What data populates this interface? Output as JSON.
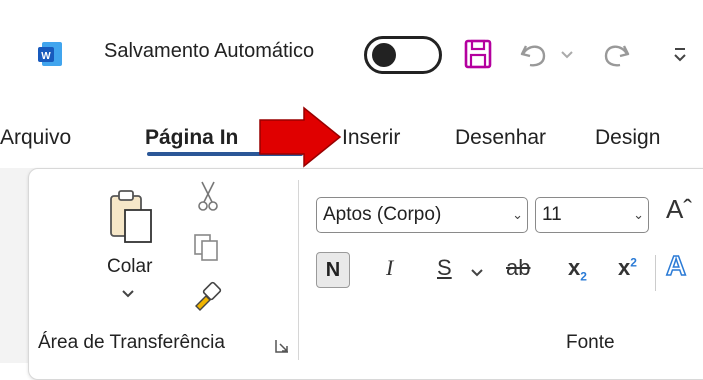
{
  "titlebar": {
    "app_icon": "word-icon",
    "autosave_label": "Salvamento Automático",
    "autosave_state": "off",
    "save_icon": "save-icon",
    "undo_icon": "undo-icon",
    "redo_icon": "redo-icon",
    "customize_icon": "customize-qat-icon"
  },
  "tabs": [
    {
      "label": "Arquivo",
      "active": false
    },
    {
      "label": "Página In",
      "active": true
    },
    {
      "label": "Inserir",
      "active": false
    },
    {
      "label": "Desenhar",
      "active": false
    },
    {
      "label": "Design",
      "active": false
    }
  ],
  "annotation": {
    "arrow_color": "#e00000"
  },
  "ribbon": {
    "clipboard": {
      "paste_label": "Colar",
      "group_label": "Área de Transferência",
      "cut_icon": "scissors-icon",
      "copy_icon": "copy-icon",
      "format_painter_icon": "format-painter-icon"
    },
    "font": {
      "font_name": "Aptos (Corpo)",
      "font_size": "11",
      "bold": "N",
      "italic": "I",
      "underline": "S",
      "strikethrough": "ab",
      "subscript": "x",
      "superscript": "x",
      "group_label": "Fonte"
    }
  },
  "colors": {
    "accent": "#2b5797",
    "save_icon": "#b4009e",
    "word_blue": "#185abd"
  }
}
